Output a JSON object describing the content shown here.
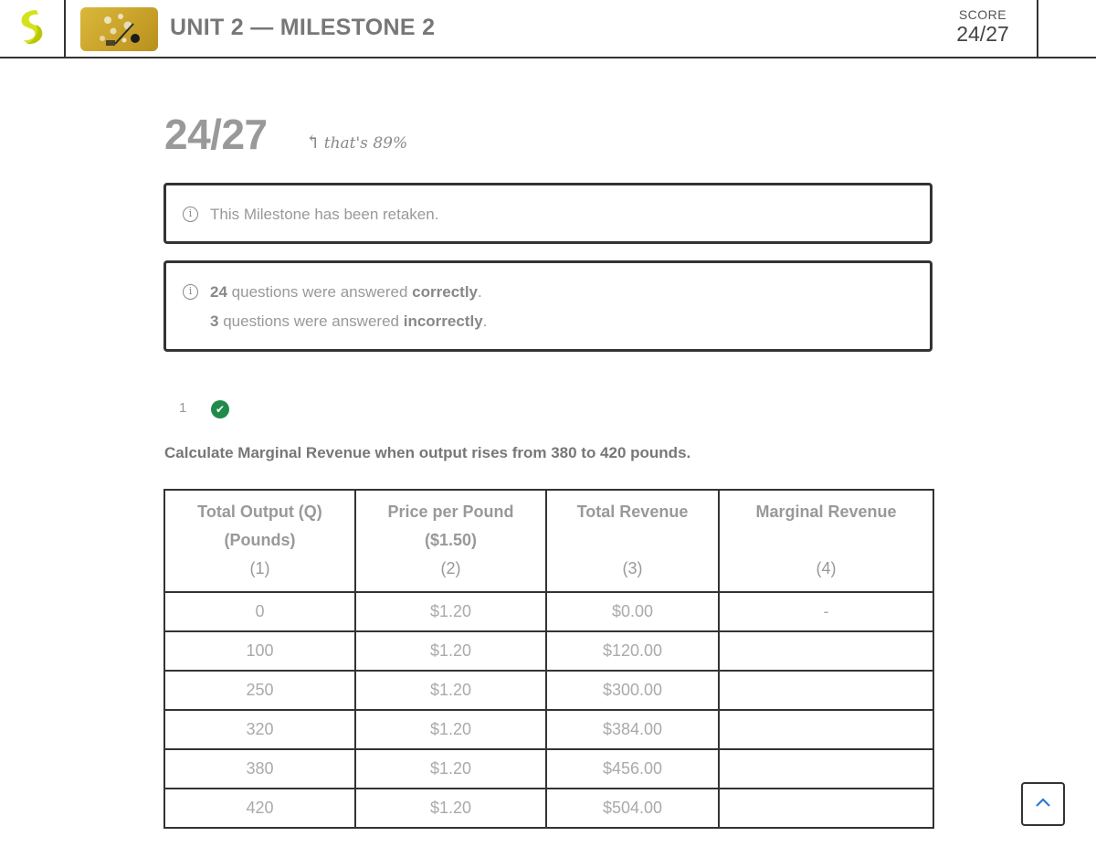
{
  "header": {
    "unit_title": "UNIT 2 — MILESTONE 2",
    "score_label": "SCORE",
    "score_value": "24/27"
  },
  "result": {
    "big_score": "24/27",
    "percent_note": "that's 89%"
  },
  "notices": {
    "retaken": "This Milestone has been retaken.",
    "correct_count": "24",
    "correct_text": "questions were answered",
    "correct_word": "correctly",
    "incorrect_count": "3",
    "incorrect_text": "questions were answered",
    "incorrect_word": "incorrectly"
  },
  "question": {
    "number": "1",
    "status": "correct",
    "status_icon": "checkmark-icon",
    "text": "Calculate Marginal Revenue when output rises from 380 to 420 pounds."
  },
  "table": {
    "headers": [
      {
        "line1": "Total Output (Q)",
        "line2": "(Pounds)",
        "line3": "(1)"
      },
      {
        "line1": "Price per Pound",
        "line2": "($1.50)",
        "line3": "(2)"
      },
      {
        "line1": "Total Revenue",
        "line2": "",
        "line3": "(3)"
      },
      {
        "line1": "Marginal Revenue",
        "line2": "",
        "line3": "(4)"
      }
    ],
    "rows": [
      [
        "0",
        "$1.20",
        "$0.00",
        "-"
      ],
      [
        "100",
        "$1.20",
        "$120.00",
        ""
      ],
      [
        "250",
        "$1.20",
        "$300.00",
        ""
      ],
      [
        "320",
        "$1.20",
        "$384.00",
        ""
      ],
      [
        "380",
        "$1.20",
        "$456.00",
        ""
      ],
      [
        "420",
        "$1.20",
        "$504.00",
        ""
      ]
    ]
  },
  "colors": {
    "accent_green": "#1f8a4c",
    "logo_yellow": "#d4e21a",
    "back_to_top_blue": "#2a7bd6"
  },
  "icons": {
    "logo": "sophia-logo-icon",
    "info": "info-icon",
    "back_to_top": "chevron-up-icon"
  }
}
